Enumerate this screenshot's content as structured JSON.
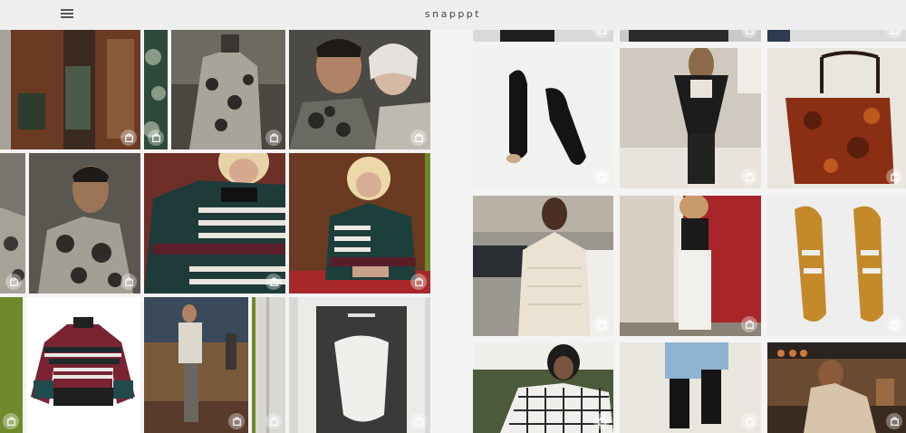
{
  "header": {
    "brand": "snapppt",
    "menu_icon": "hamburger-menu-icon",
    "background": "#efefef"
  },
  "tile_icon": "shopping-bag-icon",
  "left_feed": [
    {
      "name": "tile-library-skirt-look",
      "colors": [
        "#6a3a22",
        "#3b4a3c"
      ]
    },
    {
      "name": "tile-print-pattern-detail",
      "colors": [
        "#2e4a3a",
        "#8a9a86"
      ]
    },
    {
      "name": "tile-floral-coat-stairs",
      "colors": [
        "#6f6a60",
        "#2c2a26"
      ]
    },
    {
      "name": "tile-floral-shirt-couple",
      "colors": [
        "#4b4a44",
        "#bfbab0"
      ]
    },
    {
      "name": "tile-staircase-crop",
      "colors": [
        "#7a766e",
        "#3a3834"
      ]
    },
    {
      "name": "tile-floral-shirt-man",
      "colors": [
        "#5a5650",
        "#2d2c29"
      ]
    },
    {
      "name": "tile-striped-sweater-closeup",
      "colors": [
        "#6e2f28",
        "#1f3b39"
      ]
    },
    {
      "name": "tile-striped-sweater-seated",
      "colors": [
        "#6b3a22",
        "#1d3f3c"
      ]
    },
    {
      "name": "tile-green-block",
      "colors": [
        "#6f8a2a",
        "#5e7a22"
      ]
    },
    {
      "name": "tile-striped-sweater-product",
      "colors": [
        "#ffffff",
        "#7a2332"
      ]
    },
    {
      "name": "tile-fleece-vest-look",
      "colors": [
        "#7a5a3a",
        "#3a3632"
      ]
    },
    {
      "name": "tile-curtain-crop",
      "colors": [
        "#d9d7d2",
        "#6f8a2a"
      ]
    },
    {
      "name": "tile-the-youth-tee",
      "colors": [
        "#3a3a38",
        "#d8d8d4"
      ]
    }
  ],
  "right_feed": [
    {
      "name": "tile-top-crop-1",
      "colors": [
        "#1f1f1f",
        "#d9d9d9"
      ]
    },
    {
      "name": "tile-top-crop-2",
      "colors": [
        "#2a2a2a",
        "#c9c9c9"
      ]
    },
    {
      "name": "tile-top-crop-3",
      "colors": [
        "#2c3a52",
        "#dcdcdc"
      ]
    },
    {
      "name": "tile-black-mules",
      "colors": [
        "#f1f1ef",
        "#141414"
      ]
    },
    {
      "name": "tile-black-jacket-jeans",
      "colors": [
        "#cfc9c0",
        "#1c1c1c"
      ]
    },
    {
      "name": "tile-tortoise-tote",
      "colors": [
        "#8a2f14",
        "#e9e6e0"
      ]
    },
    {
      "name": "tile-white-knit-sweater",
      "colors": [
        "#ebe2d3",
        "#9a9690"
      ]
    },
    {
      "name": "tile-white-jeans-red-door",
      "colors": [
        "#a8262a",
        "#ece7df"
      ]
    },
    {
      "name": "tile-tan-sandals",
      "colors": [
        "#c48a2a",
        "#eeeeee"
      ]
    },
    {
      "name": "tile-gingham-coat",
      "colors": [
        "#f0efeb",
        "#2a2a2a"
      ]
    },
    {
      "name": "tile-jeans-black-socks",
      "colors": [
        "#e9e6e0",
        "#8fb3d0"
      ]
    },
    {
      "name": "tile-cafe-knit-cardigan",
      "colors": [
        "#6b4a32",
        "#d8c4a8"
      ]
    }
  ]
}
